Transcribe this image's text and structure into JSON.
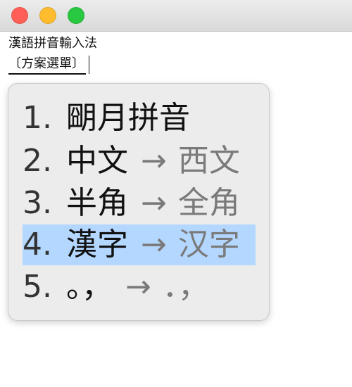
{
  "window": {
    "traffic_lights": {
      "close_color": "#ff5f57",
      "minimize_color": "#febc2e",
      "zoom_color": "#28c840"
    }
  },
  "editor": {
    "line1": "漢語拼音輸入法",
    "preedit": "〔方案選單〕"
  },
  "candidates": {
    "highlight_color": "#b4d7ff",
    "items": [
      {
        "index": "1.",
        "text": "朙月拼音",
        "arrow": "",
        "comment": ""
      },
      {
        "index": "2.",
        "text": "中文",
        "arrow": "→",
        "comment": "西文"
      },
      {
        "index": "3.",
        "text": "半角",
        "arrow": "→",
        "comment": "全角"
      },
      {
        "index": "4.",
        "text": "漢字",
        "arrow": "→",
        "comment": "汉字"
      },
      {
        "index": "5.",
        "text": "。，",
        "arrow": "→",
        "comment": "．，"
      }
    ]
  }
}
